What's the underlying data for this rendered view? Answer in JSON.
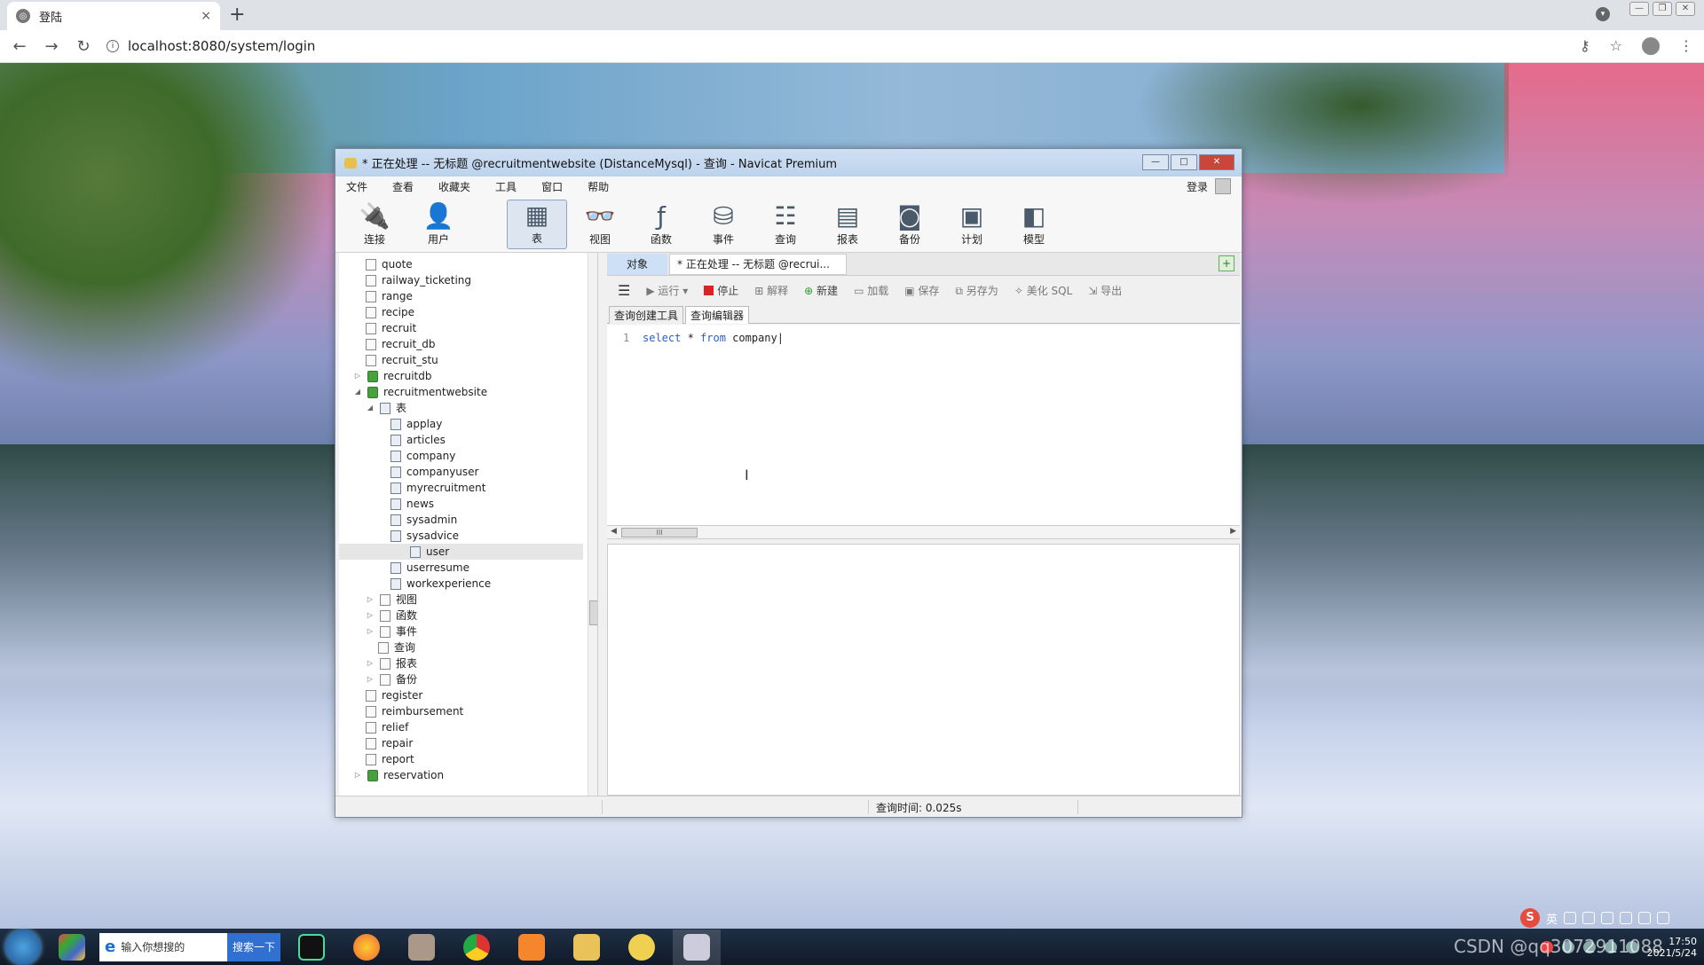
{
  "browser": {
    "tab_title": "登陆",
    "tab_close": "×",
    "new_tab": "+",
    "url": "localhost:8080/system/login",
    "icons": [
      "back-icon",
      "forward-icon",
      "reload-icon",
      "info-icon",
      "key-icon",
      "star-icon",
      "profile-icon",
      "menu-icon"
    ]
  },
  "navicat": {
    "title": "* 正在处理 -- 无标题 @recruitmentwebsite (DistanceMysql) - 查询 - Navicat Premium",
    "menu": [
      "文件",
      "查看",
      "收藏夹",
      "工具",
      "窗口",
      "帮助"
    ],
    "login_label": "登录",
    "toolbar": [
      {
        "label": "连接",
        "icon": "plug-icon"
      },
      {
        "label": "用户",
        "icon": "user-icon"
      },
      {
        "label": "表",
        "icon": "table-icon"
      },
      {
        "label": "视图",
        "icon": "view-icon"
      },
      {
        "label": "函数",
        "icon": "function-icon"
      },
      {
        "label": "事件",
        "icon": "event-icon"
      },
      {
        "label": "查询",
        "icon": "query-icon"
      },
      {
        "label": "报表",
        "icon": "report-icon"
      },
      {
        "label": "备份",
        "icon": "backup-icon"
      },
      {
        "label": "计划",
        "icon": "schedule-icon"
      },
      {
        "label": "模型",
        "icon": "model-icon"
      }
    ],
    "toolbar_active": "表",
    "tree": {
      "items": [
        "quote",
        "railway_ticketing",
        "range",
        "recipe",
        "recruit",
        "recruit_db",
        "recruit_stu",
        "recruitdb",
        "recruitmentwebsite",
        "表",
        "applay",
        "articles",
        "company",
        "companyuser",
        "myrecruitment",
        "news",
        "sysadmin",
        "sysadvice",
        "user",
        "userresume",
        "workexperience",
        "视图",
        "函数",
        "事件",
        "查询",
        "报表",
        "备份",
        "register",
        "reimbursement",
        "relief",
        "repair",
        "report",
        "reservation"
      ],
      "selected": "user"
    },
    "tabs": {
      "object_tab": "对象",
      "query_tab": "* 正在处理 -- 无标题 @recrui..."
    },
    "query_toolbar": {
      "run": "运行",
      "stop": "停止",
      "explain": "解释",
      "new": "新建",
      "load": "加载",
      "save": "保存",
      "save_as": "另存为",
      "beautify": "美化 SQL",
      "export": "导出"
    },
    "subtabs": [
      "查询创建工具",
      "查询编辑器"
    ],
    "subtab_active": "查询编辑器",
    "editor": {
      "line_number": "1",
      "kw_select": "select",
      "star": " * ",
      "kw_from": "from",
      "table": " company"
    },
    "scroll_grip": "III",
    "status": {
      "query_time": "查询时间: 0.025s"
    }
  },
  "ime": {
    "logo": "S",
    "lang": "英"
  },
  "taskbar": {
    "search_placeholder": "输入你想搜的",
    "search_button": "搜索一下",
    "time": "17:50",
    "date": "2021/5/24",
    "watermark": "CSDN @qq3072911088"
  }
}
